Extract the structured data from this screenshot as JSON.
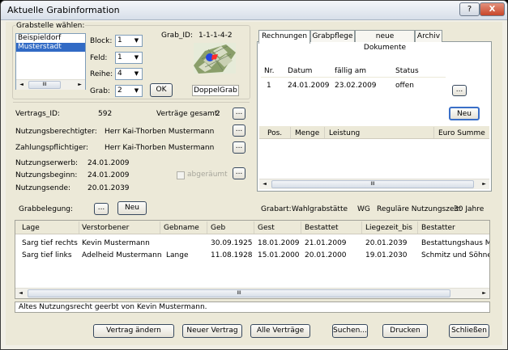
{
  "window": {
    "title": "Aktuelle Grabinformation",
    "help_label": "?",
    "close_label": "X"
  },
  "grabstelle": {
    "group_label": "Grabstelle wählen:",
    "locations": [
      "Beispieldorf",
      "Musterstadt"
    ],
    "selected_location": "Musterstadt",
    "block_label": "Block:",
    "block_value": "1",
    "feld_label": "Feld:",
    "feld_value": "1",
    "reihe_label": "Reihe:",
    "reihe_value": "4",
    "grab_label": "Grab:",
    "grab_value": "2",
    "ok_label": "OK",
    "grab_id_label": "Grab_ID:",
    "grab_id_value": "1-1-1-4-2",
    "grab_type": "DoppelGrab"
  },
  "vertrag": {
    "vertrags_id_label": "Vertrags_ID:",
    "vertrags_id_value": "592",
    "vertraege_gesamt_label": "Verträge gesamt:",
    "vertraege_gesamt_value": "2",
    "nutzungsberechtigter_label": "Nutzungsberechtigter:",
    "nutzungsberechtigter_value": "Herr  Kai-Thorben Mustermann",
    "zahlungspflichtiger_label": "Zahlungspflichtiger:",
    "zahlungspflichtiger_value": "Herr  Kai-Thorben Mustermann",
    "nutzungserwerb_label": "Nutzungserwerb:",
    "nutzungserwerb_value": "24.01.2009",
    "nutzungsbeginn_label": "Nutzungsbeginn:",
    "nutzungsbeginn_value": "24.01.2009",
    "nutzungsende_label": "Nutzungsende:",
    "nutzungsende_value": "20.01.2039",
    "abgeraeumt_label": "abgeräumt",
    "dots_label": "..."
  },
  "tabs": [
    "Rechnungen",
    "Grabpflege",
    "neue Dokumente",
    "Archiv"
  ],
  "rechnungen": {
    "columns": [
      "Nr.",
      "Datum",
      "fällig am",
      "Status"
    ],
    "rows": [
      [
        "1",
        "24.01.2009",
        "23.02.2009",
        "offen"
      ]
    ],
    "neu_label": "Neu",
    "pos_columns": [
      "Pos.",
      "Menge",
      "Leistung",
      "Euro Summe"
    ]
  },
  "grabbelegung": {
    "label": "Grabbelegung:",
    "neu_label": "Neu",
    "grabart_label": "Grabart:",
    "grabart_value": "Wahlgrabstätte",
    "grabart_code": "WG",
    "nutzungszeit_label": "Reguläre Nutzungszeit:",
    "nutzungszeit_value": "30 Jahre",
    "columns": [
      "Lage",
      "Verstorbener",
      "Gebname",
      "Geb",
      "Gest",
      "Bestattet",
      "Liegezeit_bis",
      "Bestatter"
    ],
    "rows": [
      [
        "Sarg tief rechts",
        "Kevin Mustermann",
        "",
        "30.09.1925",
        "18.01.2009",
        "21.01.2009",
        "20.01.2039",
        "Bestattungshaus Me"
      ],
      [
        "Sarg tief links",
        "Adelheid Mustermann",
        "Lange",
        "11.08.1928",
        "15.01.2000",
        "20.01.2000",
        "19.01.2030",
        "Schmitz und Söhne"
      ]
    ]
  },
  "status_text": "Altes Nutzungsrecht geerbt von Kevin Mustermann.",
  "footer": {
    "vertrag_aendern": "Vertrag ändern",
    "neuer_vertrag": "Neuer Vertrag",
    "alle_vertraege": "Alle Verträge",
    "suchen": "Suchen...",
    "drucken": "Drucken",
    "schliessen": "Schließen"
  },
  "scroll": {
    "left": "◄",
    "right": "►",
    "thumb": "III"
  },
  "combo_arrow": "▼"
}
